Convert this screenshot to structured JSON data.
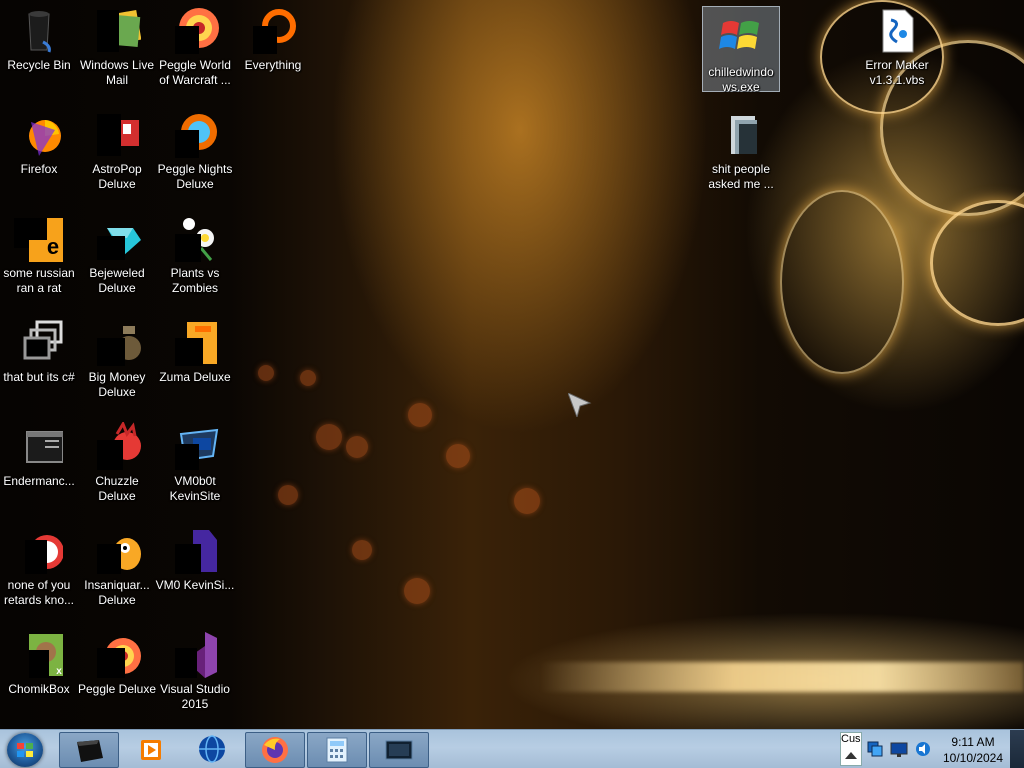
{
  "desktop": {
    "icons": [
      {
        "label": "Recycle Bin",
        "icon": "recycle-bin-icon"
      },
      {
        "label": "Windows Live Mail",
        "icon": "mail-icon"
      },
      {
        "label": "Peggle World of Warcraft ...",
        "icon": "peggle-icon"
      },
      {
        "label": "Everything",
        "icon": "search-orange-icon"
      },
      {
        "label": "Firefox",
        "icon": "firefox-icon"
      },
      {
        "label": "AstroPop Deluxe",
        "icon": "astropop-icon"
      },
      {
        "label": "Peggle Nights Deluxe",
        "icon": "peggle-nights-icon"
      },
      {
        "label": "some russian ran a rat",
        "icon": "app-orange-icon"
      },
      {
        "label": "Bejeweled Deluxe",
        "icon": "bejeweled-icon"
      },
      {
        "label": "Plants vs Zombies",
        "icon": "plants-vs-zombies-icon"
      },
      {
        "label": "that but its c#",
        "icon": "window-stack-icon"
      },
      {
        "label": "Big Money Deluxe",
        "icon": "big-money-icon"
      },
      {
        "label": "Zuma Deluxe",
        "icon": "zuma-icon"
      },
      {
        "label": "Endermanc...",
        "icon": "terminal-window-icon"
      },
      {
        "label": "Chuzzle Deluxe",
        "icon": "chuzzle-icon"
      },
      {
        "label": "VM0b0t KevinSite",
        "icon": "vm-folder-icon"
      },
      {
        "label": "none of you retards kno...",
        "icon": "app-red-icon"
      },
      {
        "label": "Insaniquar... Deluxe",
        "icon": "insaniquarium-icon"
      },
      {
        "label": "VM0 KevinSi...",
        "icon": "vm-purple-icon"
      },
      {
        "label": "ChomikBox",
        "icon": "chomikbox-icon"
      },
      {
        "label": "Peggle Deluxe",
        "icon": "peggle-deluxe-icon"
      },
      {
        "label": "Visual Studio 2015",
        "icon": "visual-studio-icon"
      },
      {
        "label": "chilledwindows.exe",
        "icon": "windows-logo-icon"
      },
      {
        "label": "shit people asked me ...",
        "icon": "folder-icon"
      },
      {
        "label": "Error Maker v1.3.1.vbs",
        "icon": "script-file-icon"
      }
    ]
  },
  "taskbar": {
    "buttons": [
      {
        "name": "file-explorer",
        "icon": "monitor-dark-icon"
      },
      {
        "name": "media-player",
        "icon": "media-player-icon"
      },
      {
        "name": "globe-app",
        "icon": "globe-icon"
      },
      {
        "name": "firefox",
        "icon": "firefox-icon"
      },
      {
        "name": "calculator",
        "icon": "calculator-icon"
      },
      {
        "name": "vm-app",
        "icon": "monitor-screen-icon"
      }
    ],
    "tray": {
      "overflow_label": "Cus",
      "clock_time": "9:11 AM",
      "clock_date": "10/10/2024"
    }
  },
  "colors": {
    "taskbar": "#b1c8de",
    "label_text": "#ffffff",
    "accent_gold": "#ffc860"
  }
}
